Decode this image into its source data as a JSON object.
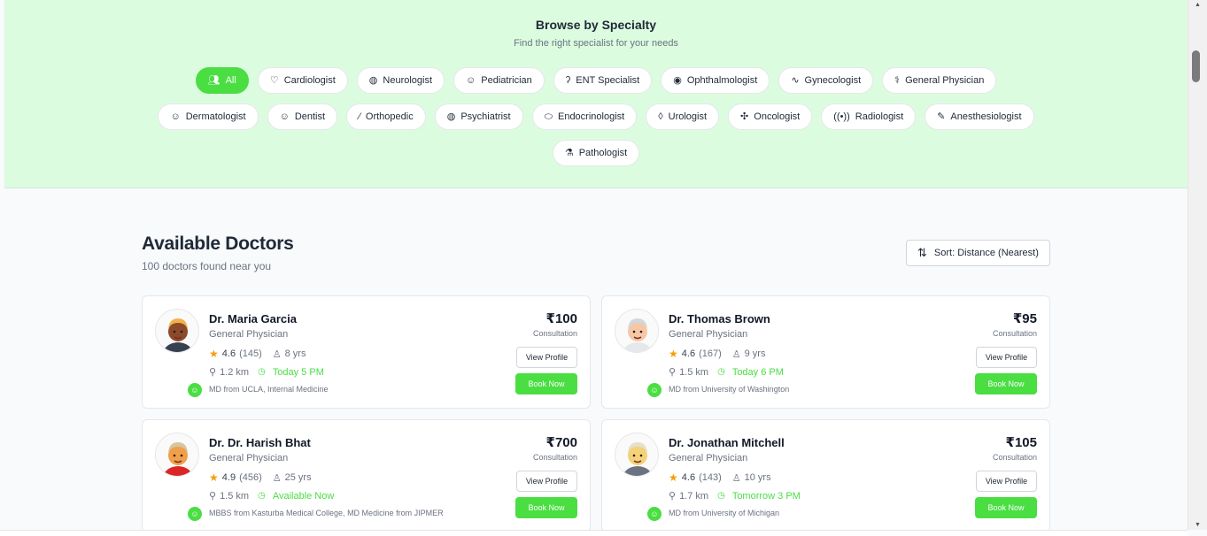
{
  "specialty": {
    "title": "Browse by Specialty",
    "subtitle": "Find the right specialist for your needs",
    "chips": [
      {
        "label": "All",
        "icon": "users-icon",
        "active": true
      },
      {
        "label": "Cardiologist",
        "icon": "heart-icon"
      },
      {
        "label": "Neurologist",
        "icon": "brain-icon"
      },
      {
        "label": "Pediatrician",
        "icon": "baby-icon"
      },
      {
        "label": "ENT Specialist",
        "icon": "ear-icon"
      },
      {
        "label": "Ophthalmologist",
        "icon": "eye-icon"
      },
      {
        "label": "Gynecologist",
        "icon": "activity-icon"
      },
      {
        "label": "General Physician",
        "icon": "stethoscope-icon"
      },
      {
        "label": "Dermatologist",
        "icon": "smile-icon"
      },
      {
        "label": "Dentist",
        "icon": "smile-icon"
      },
      {
        "label": "Orthopedic",
        "icon": "bone-icon"
      },
      {
        "label": "Psychiatrist",
        "icon": "brain-icon"
      },
      {
        "label": "Endocrinologist",
        "icon": "pill-icon"
      },
      {
        "label": "Urologist",
        "icon": "droplet-icon"
      },
      {
        "label": "Oncologist",
        "icon": "dna-icon"
      },
      {
        "label": "Radiologist",
        "icon": "radio-icon"
      },
      {
        "label": "Anesthesiologist",
        "icon": "syringe-icon"
      },
      {
        "label": "Pathologist",
        "icon": "microscope-icon"
      }
    ]
  },
  "listing": {
    "title": "Available Doctors",
    "count_text": "100 doctors found near you",
    "sort_label": "Sort: Distance (Nearest)"
  },
  "doctors": [
    {
      "name": "Dr. Maria Garcia",
      "specialty": "General Physician",
      "rating": "4.6",
      "reviews": "(145)",
      "experience": "8 yrs",
      "distance": "1.2 km",
      "availability": "Today 5 PM",
      "education": "MD from UCLA, Internal Medicine",
      "price": "₹100",
      "price_label": "Consultation",
      "view_label": "View Profile",
      "book_label": "Book Now",
      "skin": "#8b4a2b",
      "hair": "#f2b34a",
      "shirt": "#374151"
    },
    {
      "name": "Dr. Thomas Brown",
      "specialty": "General Physician",
      "rating": "4.6",
      "reviews": "(167)",
      "experience": "9 yrs",
      "distance": "1.5 km",
      "availability": "Today 6 PM",
      "education": "MD from University of Washington",
      "price": "₹95",
      "price_label": "Consultation",
      "view_label": "View Profile",
      "book_label": "Book Now",
      "skin": "#f6c7a7",
      "hair": "#cfd8dc",
      "shirt": "#e5e7eb"
    },
    {
      "name": "Dr. Dr. Harish Bhat",
      "specialty": "General Physician",
      "rating": "4.9",
      "reviews": "(456)",
      "experience": "25 yrs",
      "distance": "1.5 km",
      "availability": "Available Now",
      "education": "MBBS from Kasturba Medical College, MD Medicine from JIPMER",
      "price": "₹700",
      "price_label": "Consultation",
      "view_label": "View Profile",
      "book_label": "Book Now",
      "skin": "#f0a04b",
      "hair": "#d6c7a1",
      "shirt": "#dc2626"
    },
    {
      "name": "Dr. Jonathan Mitchell",
      "specialty": "General Physician",
      "rating": "4.6",
      "reviews": "(143)",
      "experience": "10 yrs",
      "distance": "1.7 km",
      "availability": "Tomorrow 3 PM",
      "education": "MD from University of Michigan",
      "price": "₹105",
      "price_label": "Consultation",
      "view_label": "View Profile",
      "book_label": "Book Now",
      "skin": "#f3d27a",
      "hair": "#e5e0c8",
      "shirt": "#6b7280"
    }
  ]
}
